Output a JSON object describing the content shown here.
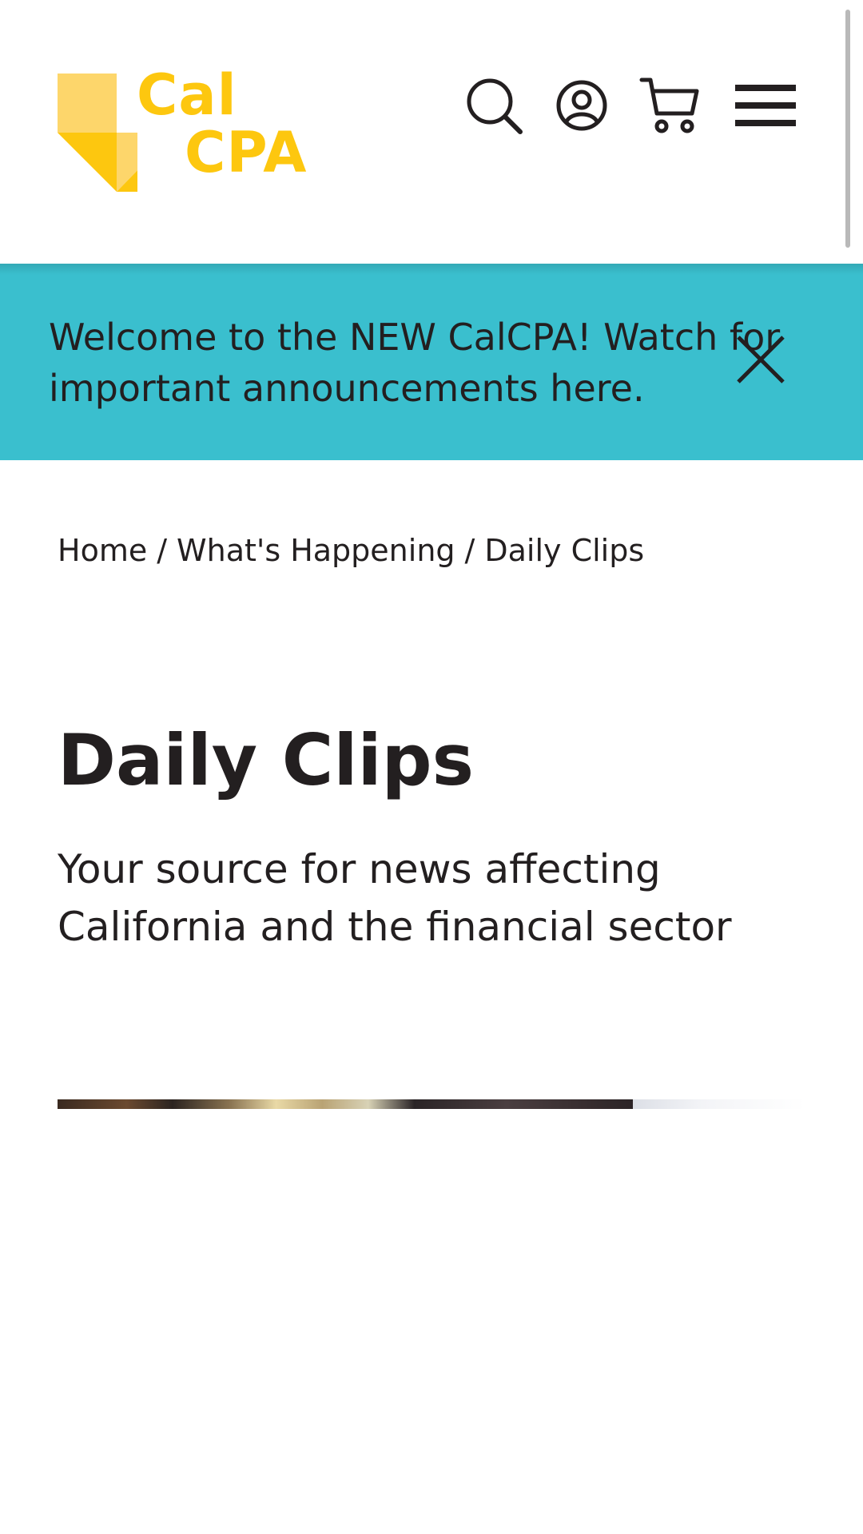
{
  "header": {
    "logo": {
      "line1": "Cal",
      "line2": "CPA",
      "brand_color": "#fdc70f",
      "brand_color_light": "#fdd66b"
    },
    "icons": [
      "search-icon",
      "user-account-icon",
      "cart-icon",
      "menu-icon"
    ]
  },
  "banner": {
    "text": "Welcome to the NEW CalCPA! Watch for important announcements here.",
    "background": "#3abfce",
    "close_icon": "close-icon"
  },
  "breadcrumb": {
    "items": [
      "Home",
      "What's Happening",
      "Daily Clips"
    ],
    "separator": "/"
  },
  "main": {
    "title": "Daily Clips",
    "subtitle": "Your source for news affecting California and the financial sector"
  },
  "colors": {
    "text": "#231f20",
    "background": "#ffffff"
  }
}
